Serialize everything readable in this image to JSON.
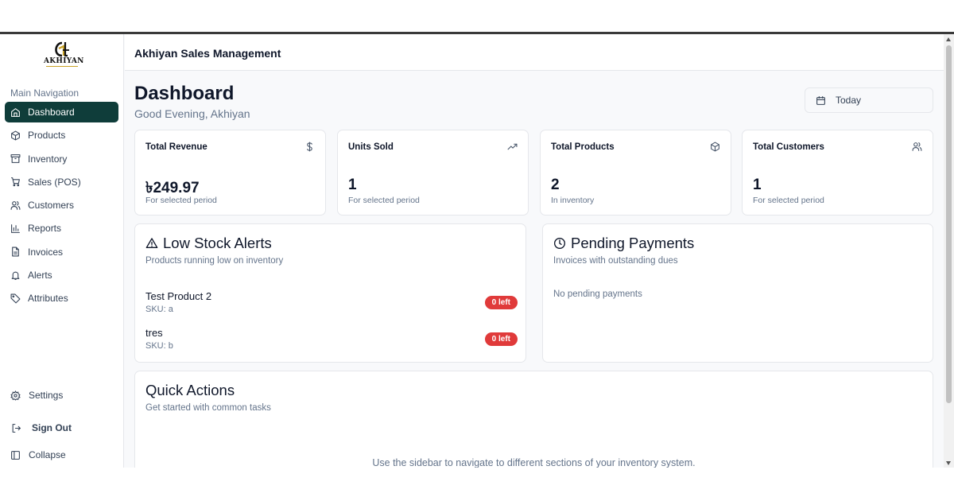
{
  "app": {
    "header_title": "Akhiyan Sales Management",
    "logo_text": "AKHIYAN"
  },
  "sidebar": {
    "heading": "Main Navigation",
    "items": [
      {
        "label": "Dashboard",
        "icon": "home-icon",
        "active": true
      },
      {
        "label": "Products",
        "icon": "package-icon"
      },
      {
        "label": "Inventory",
        "icon": "archive-icon"
      },
      {
        "label": "Sales (POS)",
        "icon": "cart-icon"
      },
      {
        "label": "Customers",
        "icon": "users-icon"
      },
      {
        "label": "Reports",
        "icon": "bar-chart-icon"
      },
      {
        "label": "Invoices",
        "icon": "file-icon"
      },
      {
        "label": "Alerts",
        "icon": "bell-icon"
      },
      {
        "label": "Attributes",
        "icon": "tag-icon"
      }
    ],
    "settings": "Settings",
    "sign_out": "Sign Out",
    "collapse": "Collapse"
  },
  "page": {
    "title": "Dashboard",
    "greeting": "Good Evening, Akhiyan",
    "date_filter": "Today"
  },
  "stats": [
    {
      "label": "Total Revenue",
      "value": "৳249.97",
      "sub": "For selected period",
      "icon": "dollar-icon"
    },
    {
      "label": "Units Sold",
      "value": "1",
      "sub": "For selected period",
      "icon": "trending-up-icon"
    },
    {
      "label": "Total Products",
      "value": "2",
      "sub": "In inventory",
      "icon": "box-icon"
    },
    {
      "label": "Total Customers",
      "value": "1",
      "sub": "For selected period",
      "icon": "users-icon"
    }
  ],
  "low_stock": {
    "title": "Low Stock Alerts",
    "description": "Products running low on inventory",
    "items": [
      {
        "name": "Test Product 2",
        "sku": "SKU: a",
        "badge": "0 left"
      },
      {
        "name": "tres",
        "sku": "SKU: b",
        "badge": "0 left"
      }
    ]
  },
  "pending": {
    "title": "Pending Payments",
    "description": "Invoices with outstanding dues",
    "empty": "No pending payments"
  },
  "quick_actions": {
    "title": "Quick Actions",
    "description": "Get started with common tasks",
    "hint": "Use the sidebar to navigate to different sections of your inventory system."
  },
  "colors": {
    "active_nav": "#0f3d3a",
    "badge": "#e03a3a",
    "muted_text": "#64748b"
  }
}
